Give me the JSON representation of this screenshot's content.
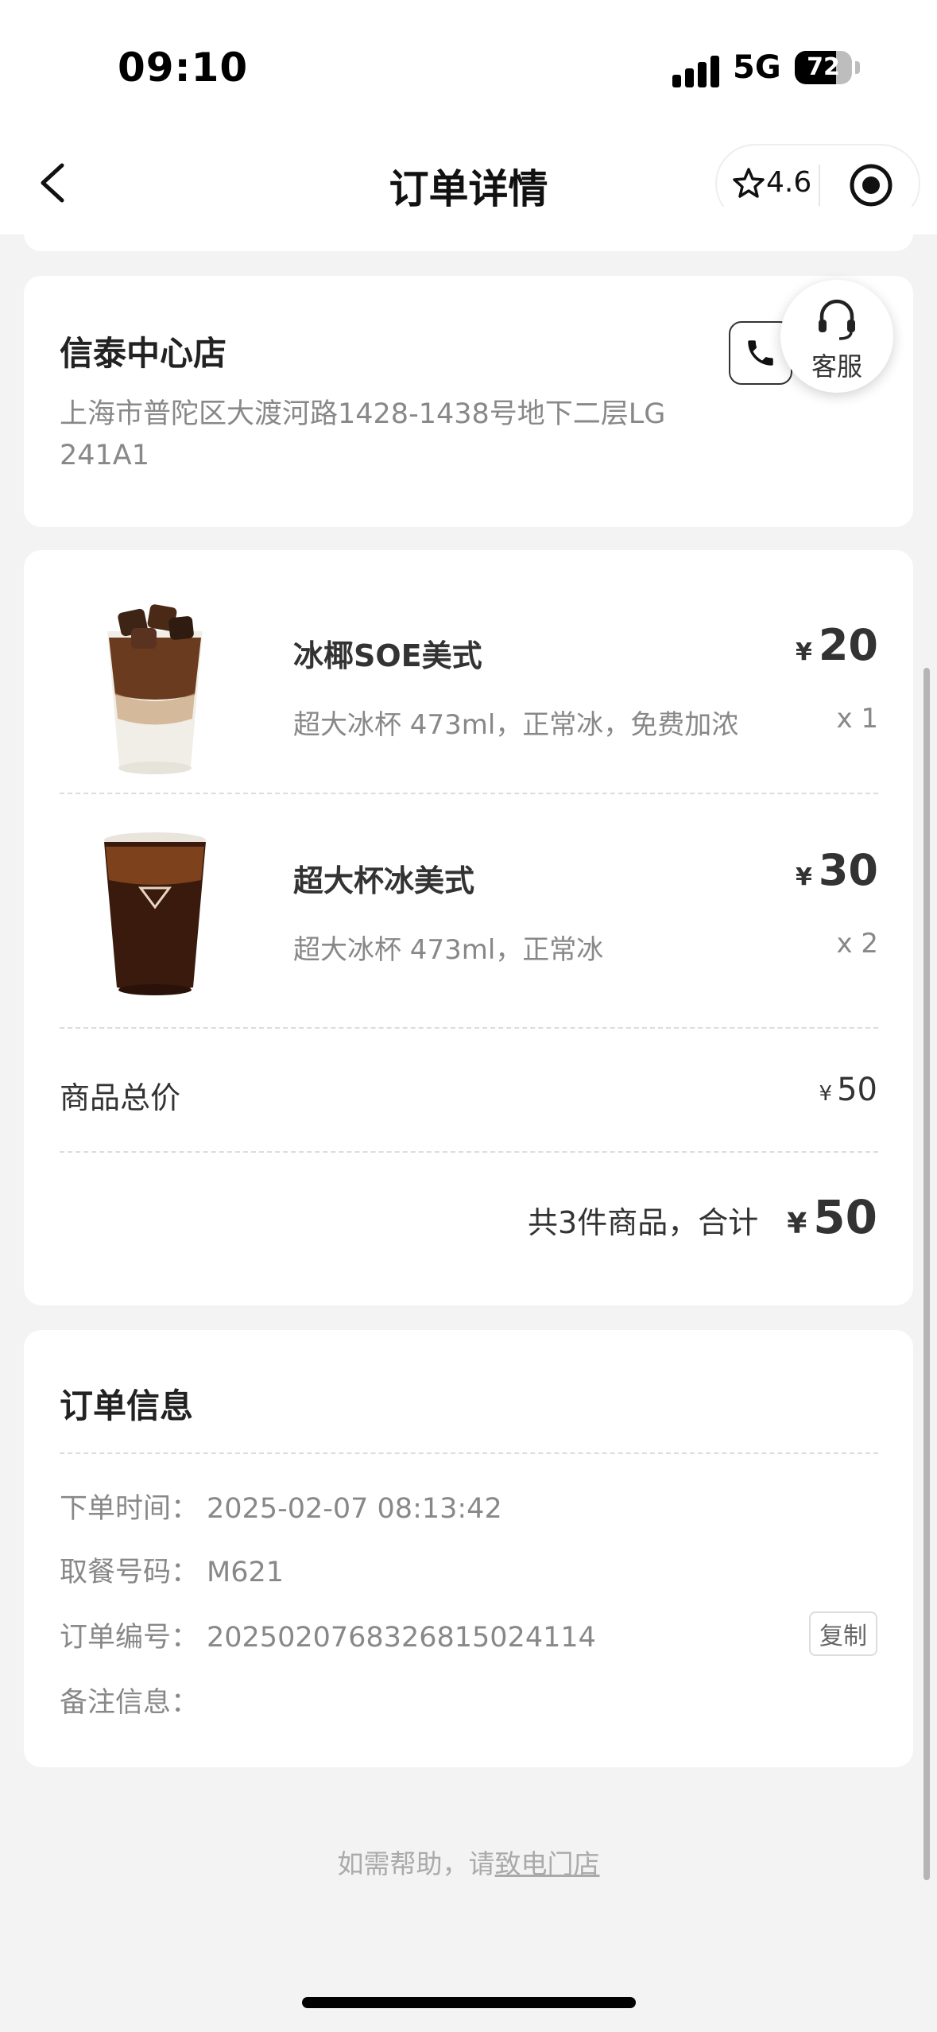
{
  "status_bar": {
    "time": "09:10",
    "network": "5G",
    "battery": "72",
    "battery_level": 0.72
  },
  "nav": {
    "title": "订单详情",
    "rating": "4.6"
  },
  "store": {
    "name": "信泰中心店",
    "address": "上海市普陀区大渡河路1428-1438号地下二层LG 241A1"
  },
  "service": {
    "label": "客服"
  },
  "items": [
    {
      "name": "冰椰SOE美式",
      "currency": "¥",
      "price": "20",
      "options": "超大冰杯 473ml，正常冰，免费加浓",
      "qty": "x 1"
    },
    {
      "name": "超大杯冰美式",
      "currency": "¥",
      "price": "30",
      "options": "超大冰杯 473ml，正常冰",
      "qty": "x 2"
    }
  ],
  "summary": {
    "subtotal_label": "商品总价",
    "currency": "¥",
    "subtotal_value": "50",
    "total_text": "共3件商品，合计",
    "total_value": "50"
  },
  "order_info": {
    "title": "订单信息",
    "rows": [
      {
        "label": "下单时间：",
        "value": "2025-02-07 08:13:42"
      },
      {
        "label": "取餐号码：",
        "value": "M621"
      },
      {
        "label": "订单编号：",
        "value": "2025020768326815024114"
      },
      {
        "label": "备注信息：",
        "value": ""
      }
    ],
    "copy_label": "复制"
  },
  "help": {
    "prefix": "如需帮助，请",
    "link": "致电门店"
  }
}
